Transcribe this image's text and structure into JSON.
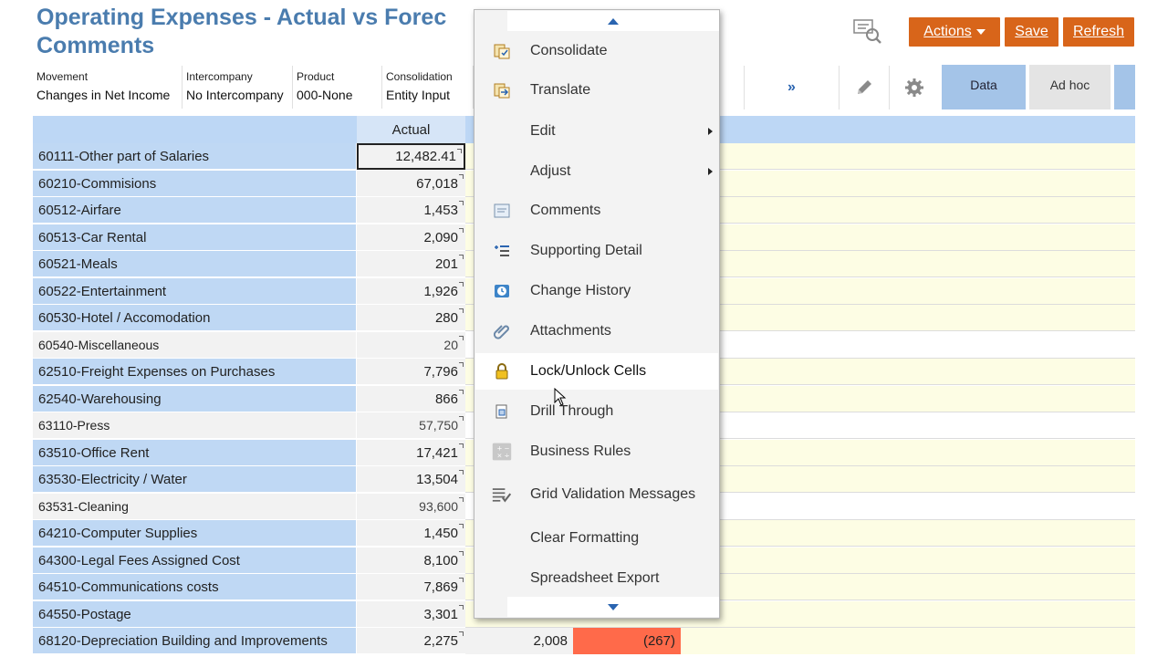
{
  "header": {
    "title_line1": "Operating Expenses - Actual vs Forec",
    "title_line2": "Comments",
    "actions_label": "Actions",
    "save_label": "Save",
    "refresh_label": "Refresh",
    "more_label": "»"
  },
  "pov": [
    {
      "label": "Movement",
      "value": "Changes in Net Income"
    },
    {
      "label": "Intercompany",
      "value": "No Intercompany"
    },
    {
      "label": "Product",
      "value": "000-None"
    },
    {
      "label": "Consolidation",
      "value": "Entity Input"
    }
  ],
  "tabs": {
    "data": "Data",
    "adhoc": "Ad hoc"
  },
  "grid": {
    "col_actual": "Actual",
    "rows": [
      {
        "account": "60111-Other part of Salaries",
        "actual": "12,482.41",
        "style": "alt",
        "selected": true
      },
      {
        "account": "60210-Commisions",
        "actual": "67,018",
        "style": "alt"
      },
      {
        "account": "60512-Airfare",
        "actual": "1,453",
        "style": "alt"
      },
      {
        "account": "60513-Car Rental",
        "actual": "2,090",
        "style": "alt"
      },
      {
        "account": "60521-Meals",
        "actual": "201",
        "style": "alt"
      },
      {
        "account": "60522-Entertainment",
        "actual": "1,926",
        "style": "alt"
      },
      {
        "account": "60530-Hotel / Accomodation",
        "actual": "280",
        "style": "alt"
      },
      {
        "account": "60540-Miscellaneous",
        "actual": "20",
        "style": "plain"
      },
      {
        "account": "62510-Freight Expenses on Purchases",
        "actual": "7,796",
        "style": "alt"
      },
      {
        "account": "62540-Warehousing",
        "actual": "866",
        "style": "alt"
      },
      {
        "account": "63110-Press",
        "actual": "57,750",
        "style": "plain"
      },
      {
        "account": "63510-Office Rent",
        "actual": "17,421",
        "style": "alt"
      },
      {
        "account": "63530-Electricity / Water",
        "actual": "13,504",
        "style": "alt"
      },
      {
        "account": "63531-Cleaning",
        "actual": "93,600",
        "style": "plain"
      },
      {
        "account": "64210-Computer Supplies",
        "actual": "1,450",
        "style": "alt"
      },
      {
        "account": "64300-Legal Fees Assigned Cost",
        "actual": "8,100",
        "style": "alt"
      },
      {
        "account": "64510-Communications costs",
        "actual": "7,869",
        "style": "alt"
      },
      {
        "account": "64550-Postage",
        "actual": "3,301",
        "style": "alt"
      },
      {
        "account": "68120-Depreciation Building and Improvements",
        "actual": "2,275",
        "style": "alt",
        "forecast": "2,008",
        "variance": "(267)"
      }
    ]
  },
  "context_menu": {
    "items": [
      {
        "label": "Consolidate",
        "icon": "consolidate-icon"
      },
      {
        "label": "Translate",
        "icon": "translate-icon"
      },
      {
        "label": "Edit",
        "icon": "",
        "submenu": true
      },
      {
        "label": "Adjust",
        "icon": "",
        "submenu": true
      },
      {
        "label": "Comments",
        "icon": "comments-icon"
      },
      {
        "label": "Supporting Detail",
        "icon": "supporting-detail-icon"
      },
      {
        "label": "Change History",
        "icon": "change-history-icon"
      },
      {
        "label": "Attachments",
        "icon": "paperclip-icon"
      },
      {
        "label": "Lock/Unlock Cells",
        "icon": "lock-icon",
        "hover": true
      },
      {
        "label": "Drill Through",
        "icon": "drill-through-icon"
      },
      {
        "label": "Business Rules",
        "icon": "calculator-icon"
      },
      {
        "label": "Grid Validation Messages",
        "icon": "validation-icon"
      },
      {
        "label": "Clear Formatting",
        "icon": ""
      },
      {
        "label": "Spreadsheet Export",
        "icon": ""
      }
    ]
  },
  "colors": {
    "title": "#4a7cae",
    "button": "#d8651a",
    "row_header": "#bfd8f4",
    "input_cell": "#fdfde4",
    "negative_variance": "#ff6a4a"
  }
}
